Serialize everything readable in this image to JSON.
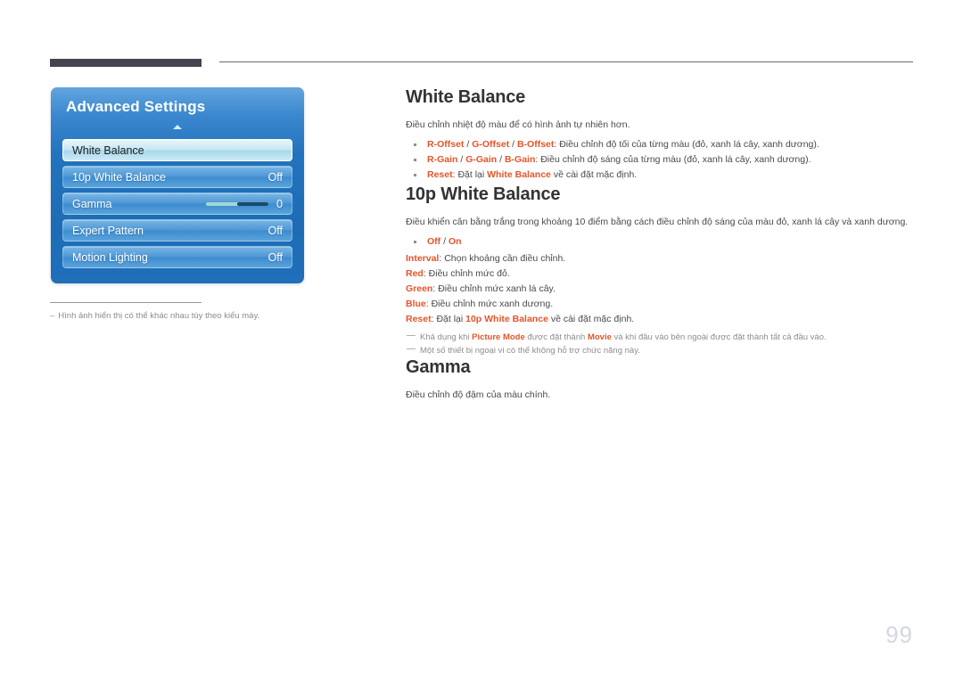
{
  "page": {
    "number": "99"
  },
  "osd": {
    "title": "Advanced Settings",
    "scroll_up_icon": "triangle-up-icon",
    "items": [
      {
        "label": "White Balance",
        "value": "",
        "selected": true,
        "type": "row"
      },
      {
        "label": "10p White Balance",
        "value": "Off",
        "selected": false,
        "type": "row"
      },
      {
        "label": "Gamma",
        "value": "0",
        "selected": false,
        "type": "slider",
        "slider_percent": 50
      },
      {
        "label": "Expert Pattern",
        "value": "Off",
        "selected": false,
        "type": "row"
      },
      {
        "label": "Motion Lighting",
        "value": "Off",
        "selected": false,
        "type": "row"
      }
    ]
  },
  "caption": {
    "dash": "–",
    "text": "Hình ảnh hiển thị có thể khác nhau tùy theo kiểu máy."
  },
  "sections": {
    "white_balance": {
      "title": "White Balance",
      "intro": "Điều chỉnh nhiệt độ màu để có hình ảnh tự nhiên hơn.",
      "bullets": [
        {
          "options": [
            "R-Offset",
            "G-Offset",
            "B-Offset"
          ],
          "separator": " / ",
          "desc": ": Điều chỉnh độ tối của từng màu (đỏ, xanh lá cây, xanh dương)."
        },
        {
          "options": [
            "R-Gain",
            "G-Gain",
            "B-Gain"
          ],
          "separator": " / ",
          "desc": ": Điều chỉnh độ sáng của từng màu (đỏ, xanh lá cây, xanh dương)."
        },
        {
          "options": [
            "Reset"
          ],
          "separator": " / ",
          "desc_pre": ": Đặt lại ",
          "desc_hl": "White Balance",
          "desc_post": " về cài đặt mặc định."
        }
      ]
    },
    "ten_p_white_balance": {
      "title": "10p White Balance",
      "intro": "Điều khiển cân bằng trắng trong khoảng 10 điểm bằng cách điều chỉnh độ sáng của màu đỏ, xanh lá cây và xanh dương.",
      "bullet_off_on": {
        "off": "Off",
        "sep": " / ",
        "on": "On"
      },
      "definitions": [
        {
          "term": "Interval",
          "desc": ": Chọn khoảng cần điều chỉnh."
        },
        {
          "term": "Red",
          "desc": ": Điều chỉnh mức đỏ."
        },
        {
          "term": "Green",
          "desc": ": Điều chỉnh mức xanh lá cây."
        },
        {
          "term": "Blue",
          "desc": ": Điều chỉnh mức xanh dương."
        }
      ],
      "reset": {
        "term": "Reset",
        "pre": ": Đặt lại ",
        "hl": "10p White Balance",
        "post": " về cài đặt mặc định."
      },
      "notes": [
        {
          "p1": "Khả dụng khi ",
          "h1": "Picture Mode",
          "p2": " được đặt thành ",
          "h2": "Movie",
          "p3": " và khi đầu vào bên ngoài được đặt thành tất cả đầu vào."
        },
        {
          "p1": "Một số thiết bị ngoại vi có thể không hỗ trợ chức năng này.",
          "h1": "",
          "p2": "",
          "h2": "",
          "p3": ""
        }
      ]
    },
    "gamma": {
      "title": "Gamma",
      "intro": "Điều chỉnh độ đậm của màu chính."
    }
  },
  "colors": {
    "accent_orange": "#e4542a",
    "panel_blue": "#1f6fba",
    "rule_dark": "#474450",
    "page_number": "#d4d7e0"
  }
}
